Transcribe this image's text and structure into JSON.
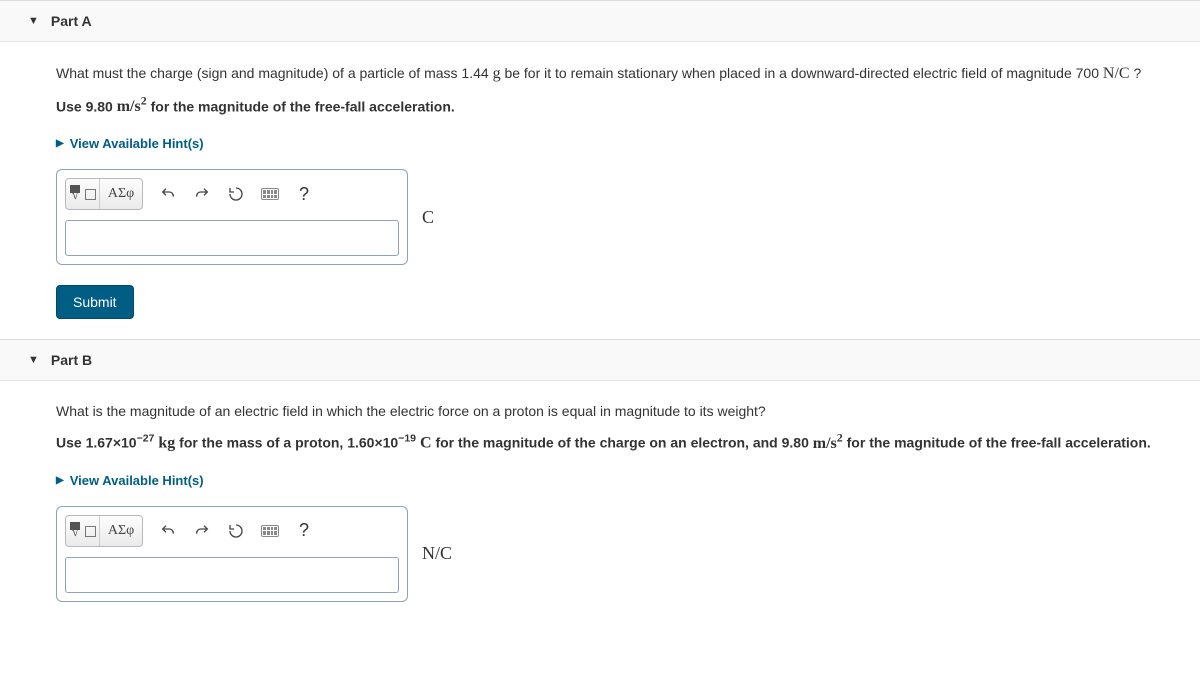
{
  "partA": {
    "title": "Part A",
    "prompt_prefix": "What must the charge (sign and magnitude) of a particle of mass 1.44 ",
    "prompt_unit1": "g",
    "prompt_mid": " be for it to remain stationary when placed in a downward-directed electric field of magnitude 700 ",
    "prompt_unit2": "N/C",
    "prompt_suffix": " ?",
    "instruction_prefix": "Use 9.80 ",
    "instruction_unit": "m/s",
    "instruction_exp": "2",
    "instruction_suffix": " for the magnitude of the free-fall acceleration.",
    "hints_label": "View Available Hint(s)",
    "toolbar": {
      "greek": "ΑΣφ",
      "help": "?"
    },
    "answer_value": "",
    "units": "C",
    "submit": "Submit"
  },
  "partB": {
    "title": "Part B",
    "prompt": "What is the magnitude of an electric field in which the electric force on a proton is equal in magnitude to its weight?",
    "instr": {
      "p1": "Use 1.67×10",
      "e1": "−27",
      "u1": " kg",
      "p2": " for the mass of a proton, 1.60×10",
      "e2": "−19",
      "u2": " C",
      "p3": " for the magnitude of the charge on an electron, and 9.80 ",
      "u3": "m/s",
      "e3": "2",
      "p4": " for the magnitude of the free-fall acceleration."
    },
    "hints_label": "View Available Hint(s)",
    "toolbar": {
      "greek": "ΑΣφ",
      "help": "?"
    },
    "answer_value": "",
    "units": "N/C"
  }
}
